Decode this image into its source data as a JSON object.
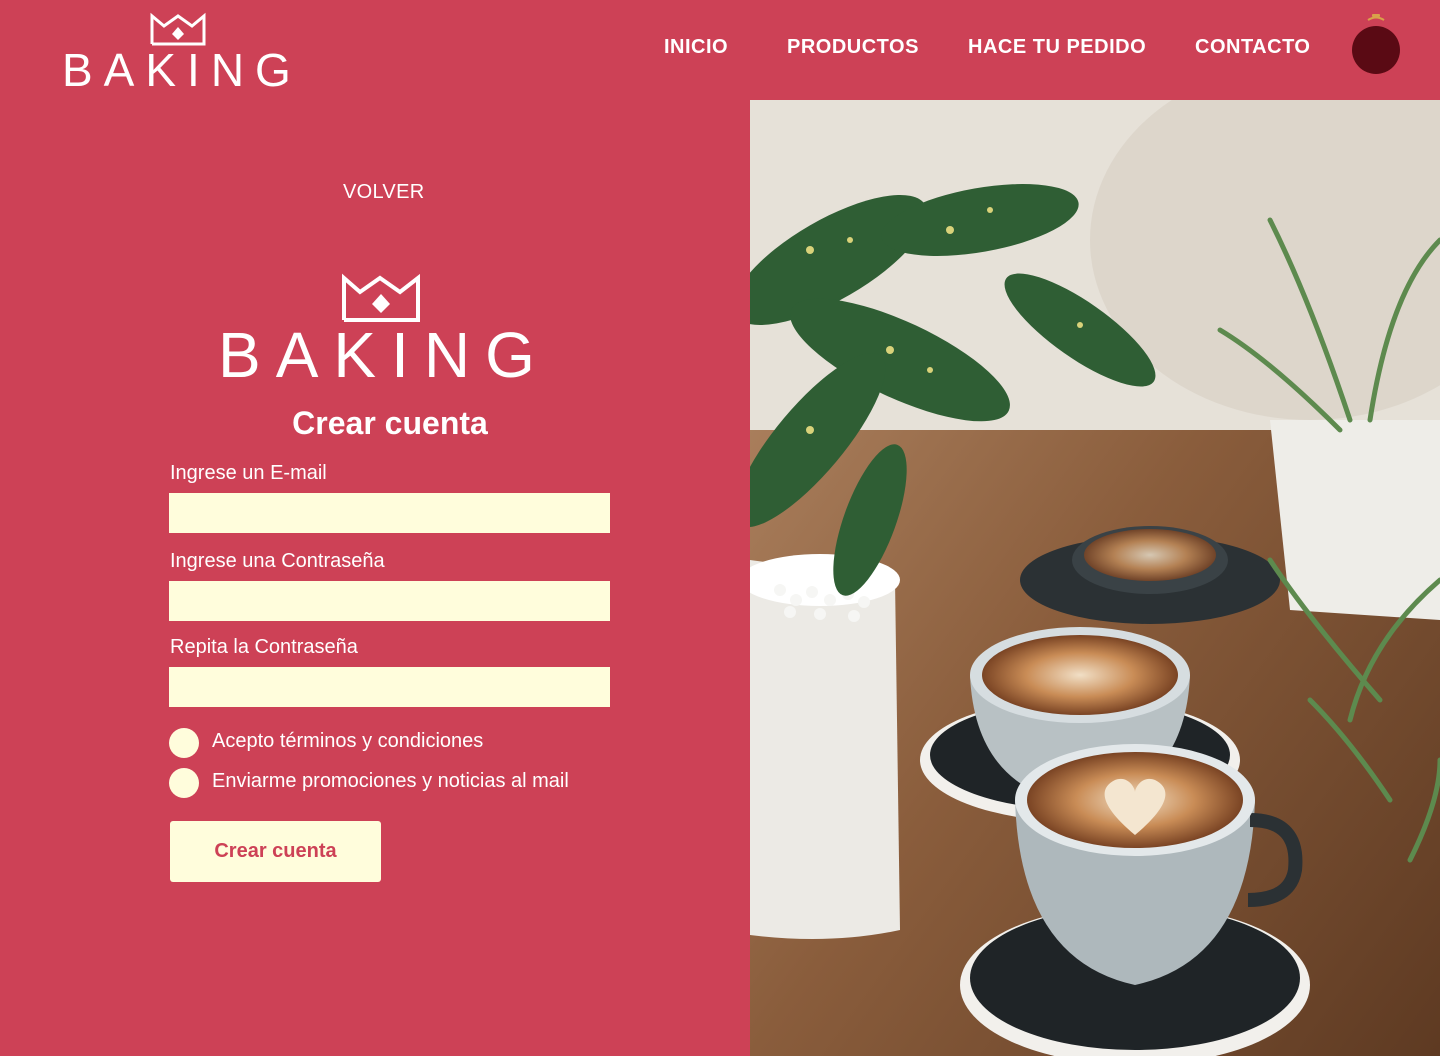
{
  "brand": {
    "name": "BAKING"
  },
  "nav": {
    "items": [
      {
        "label": "INICIO"
      },
      {
        "label": "PRODUCTOS"
      },
      {
        "label": "HACE TU PEDIDO"
      },
      {
        "label": "CONTACTO"
      }
    ],
    "cart_icon": "cart-pot-icon"
  },
  "form": {
    "back_label": "VOLVER",
    "title": "Crear cuenta",
    "email_label": "Ingrese un E-mail",
    "email_value": "",
    "password_label": "Ingrese una Contraseña",
    "password_value": "",
    "repeat_label": "Repita la Contraseña",
    "repeat_value": "",
    "terms_label": "Acepto términos y condiciones",
    "promo_label": "Enviarme promociones y noticias al mail",
    "submit_label": "Crear cuenta"
  },
  "colors": {
    "background": "#cd4156",
    "input_bg": "#fffddc",
    "cart": "#5a0a14",
    "text": "#ffffff"
  },
  "hero_image": {
    "subject": "latte-art-coffee-cups-with-plants"
  }
}
